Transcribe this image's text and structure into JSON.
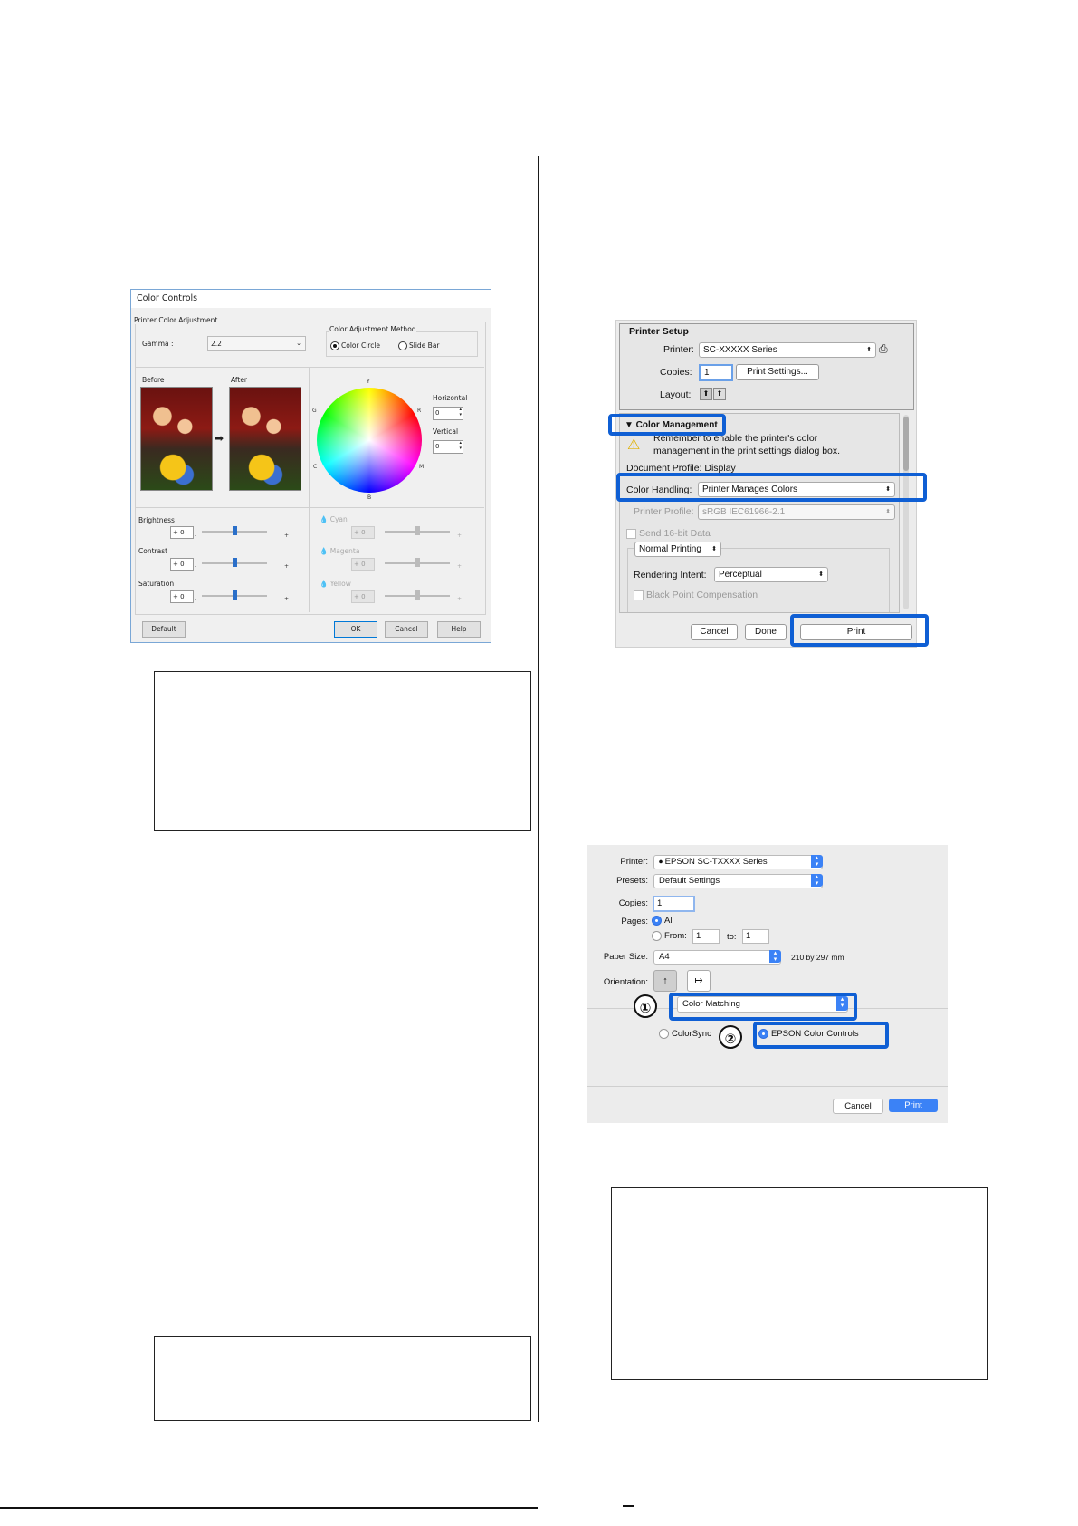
{
  "win_dialog": {
    "title": "Color Controls",
    "group_printer_adjust": "Printer Color Adjustment",
    "gamma_label": "Gamma :",
    "gamma_value": "2.2",
    "method_group": "Color Adjustment Method",
    "method_circle": "Color Circle",
    "method_slide": "Slide Bar",
    "before_label": "Before",
    "after_label": "After",
    "wheel_y": "Y",
    "wheel_r": "R",
    "wheel_m": "M",
    "wheel_b": "B",
    "wheel_c": "C",
    "wheel_g": "G",
    "horizontal_label": "Horizontal",
    "horizontal_value": "0",
    "vertical_label": "Vertical",
    "vertical_value": "0",
    "brightness_label": "Brightness",
    "brightness_value": "+ 0",
    "contrast_label": "Contrast",
    "contrast_value": "+ 0",
    "saturation_label": "Saturation",
    "saturation_value": "+ 0",
    "cyan_label": "Cyan",
    "magenta_label": "Magenta",
    "yellow_label": "Yellow",
    "cmy_value": "+ 0",
    "minus": "-",
    "plus": "+",
    "default_button": "Default",
    "ok_button": "OK",
    "cancel_button": "Cancel",
    "help_button": "Help"
  },
  "mac_setup": {
    "section_title": "Printer Setup",
    "printer_label": "Printer:",
    "printer_value": "SC-XXXXX Series",
    "copies_label": "Copies:",
    "copies_value": "1",
    "print_settings_button": "Print Settings...",
    "layout_label": "Layout:",
    "color_mgmt_title": "▼ Color Management",
    "warning_text_1": "Remember to enable the printer's color",
    "warning_text_2": "management in the print settings dialog box.",
    "doc_profile": "Document Profile: Display",
    "color_handling_label": "Color Handling:",
    "color_handling_value": "Printer Manages Colors",
    "printer_profile_label": "Printer Profile:",
    "printer_profile_value": "sRGB IEC61966-2.1",
    "send16": "Send 16-bit Data",
    "normal_printing": "Normal Printing",
    "rendering_label": "Rendering Intent:",
    "rendering_value": "Perceptual",
    "bpc": "Black Point Compensation",
    "cancel_button": "Cancel",
    "done_button": "Done",
    "print_button": "Print"
  },
  "mac_print": {
    "printer_label": "Printer:",
    "printer_value": "EPSON SC-TXXXX Series",
    "presets_label": "Presets:",
    "presets_value": "Default Settings",
    "copies_label": "Copies:",
    "copies_value": "1",
    "pages_label": "Pages:",
    "pages_all": "All",
    "pages_from": "From:",
    "from_value": "1",
    "to_label": "to:",
    "to_value": "1",
    "paper_label": "Paper Size:",
    "paper_value": "A4",
    "paper_dims": "210 by 297 mm",
    "orientation_label": "Orientation:",
    "section_value": "Color Matching",
    "colorsync": "ColorSync",
    "epson_controls": "EPSON Color Controls",
    "callout_1": "①",
    "callout_2": "②",
    "cancel_button": "Cancel",
    "print_button": "Print"
  }
}
